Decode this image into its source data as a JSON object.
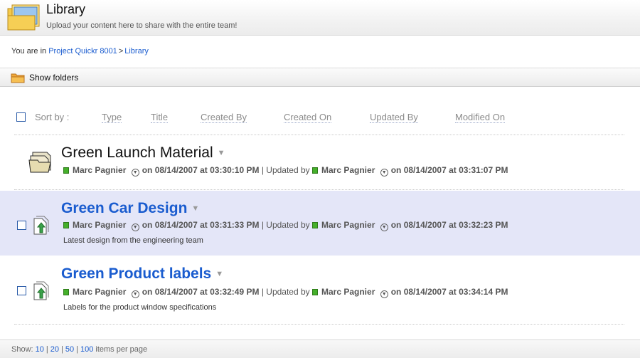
{
  "header": {
    "title": "Library",
    "subtitle": "Upload your content here to share with the entire team!"
  },
  "breadcrumb": {
    "prefix": "You are in",
    "project": "Project Quickr 8001",
    "separator": ">",
    "current": "Library"
  },
  "toolbar": {
    "show_folders": "Show folders"
  },
  "sort": {
    "label": "Sort by :",
    "options": [
      "Type",
      "Title",
      "Created By",
      "Created On",
      "Updated By",
      "Modified On"
    ]
  },
  "items": [
    {
      "type": "folder",
      "title": "Green Launch Material",
      "created_by": "Marc Pagnier",
      "created_on": "on 08/14/2007 at 03:30:10 PM",
      "updated_label": "| Updated by",
      "updated_by": "Marc Pagnier",
      "updated_on": "on 08/14/2007 at 03:31:07 PM",
      "description": ""
    },
    {
      "type": "document",
      "title": "Green Car Design",
      "created_by": "Marc Pagnier",
      "created_on": "on 08/14/2007 at 03:31:33 PM",
      "updated_label": "| Updated by",
      "updated_by": "Marc Pagnier",
      "updated_on": "on 08/14/2007 at 03:32:23 PM",
      "description": "Latest design from the engineering team",
      "selected": true
    },
    {
      "type": "document",
      "title": "Green Product labels",
      "created_by": "Marc Pagnier",
      "created_on": "on 08/14/2007 at 03:32:49 PM",
      "updated_label": "| Updated by",
      "updated_by": "Marc Pagnier",
      "updated_on": "on 08/14/2007 at 03:34:14 PM",
      "description": "Labels for the product window specifications"
    }
  ],
  "footer": {
    "prefix": "Show:",
    "page_sizes": [
      "10",
      "20",
      "50",
      "100"
    ],
    "suffix": "items per page"
  },
  "colors": {
    "link": "#1a5ccf",
    "selected_row": "#e4e6f8",
    "online": "#45b02b"
  },
  "icons": {
    "library": "library-folder-icon",
    "show_folders": "folder-icon",
    "folder_item": "folder-stack-icon",
    "document_item": "document-upload-icon",
    "online": "online-status-icon",
    "person_menu": "person-menu-icon",
    "title_menu": "chevron-down-icon"
  }
}
